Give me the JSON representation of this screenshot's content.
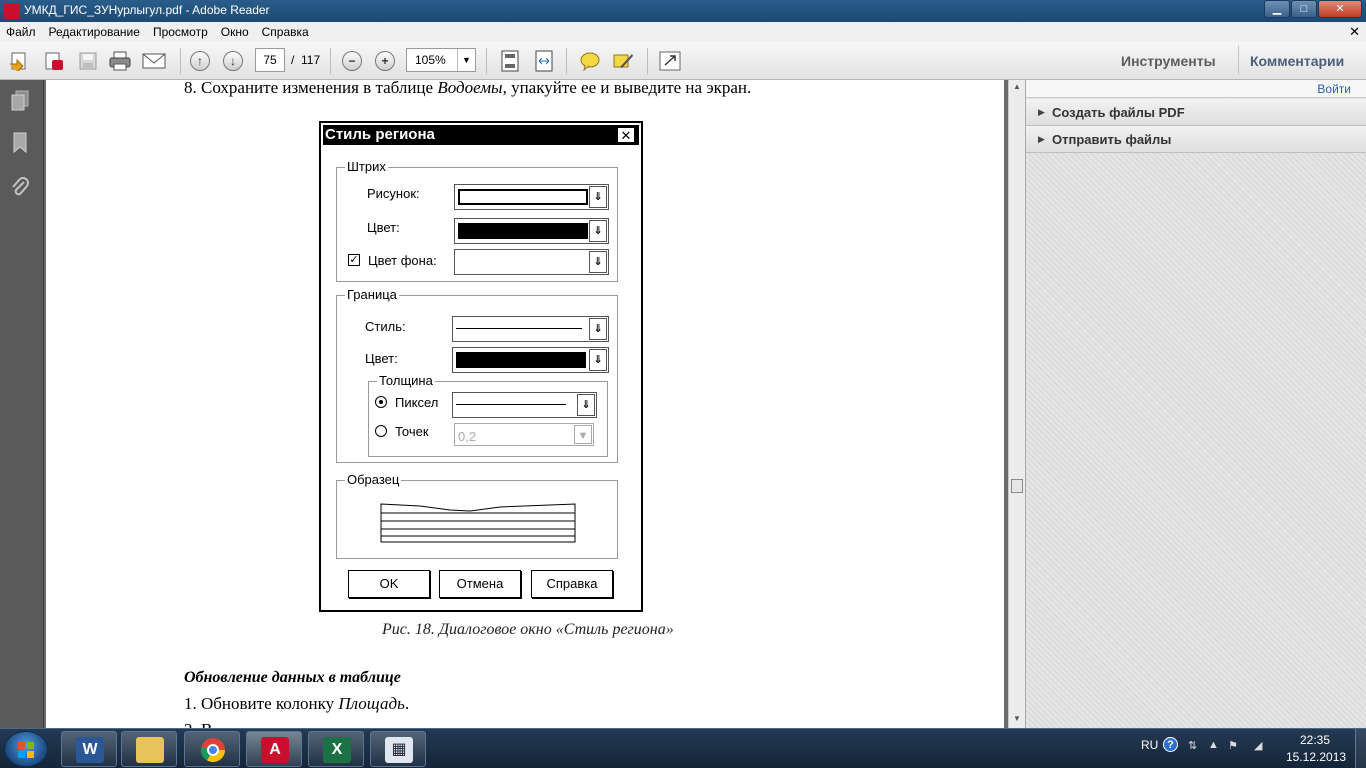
{
  "window": {
    "title": "УМКД_ГИС_ЗУНурлыгул.pdf - Adobe Reader",
    "controls": {
      "minimize": "▁",
      "maximize": "□",
      "close": "✕"
    }
  },
  "menu": {
    "items": [
      "Файл",
      "Редактирование",
      "Просмотр",
      "Окно",
      "Справка"
    ],
    "close_glyph": "✕"
  },
  "toolbar": {
    "current_page": "75",
    "page_separator": "/",
    "total_pages": "117",
    "zoom": "105%",
    "tools_label": "Инструменты",
    "comments_label": "Комментарии"
  },
  "document": {
    "line8": {
      "prefix": "8. Сохраните изменения в таблице ",
      "italic": "Водоемы",
      "suffix": ", упакуйте ее и выведите на экран."
    },
    "caption": "Рис. 18. Диалоговое окно «Стиль региона»",
    "section_heading": "Обновление данных в таблице",
    "line1": {
      "prefix": "1. Обновите колонку ",
      "italic": "Площадь",
      "suffix": "."
    },
    "line2_partial": "2. В"
  },
  "dialog": {
    "title": "Стиль региона",
    "close_glyph": "✕",
    "stroke_group": "Штрих",
    "pattern_label": "Рисунок:",
    "color_label": "Цвет:",
    "bgcolor_label": "Цвет фона:",
    "bgcolor_checked": true,
    "border_group": "Граница",
    "style_label": "Стиль:",
    "border_color_label": "Цвет:",
    "thickness_group": "Толщина",
    "pixel_label": "Пиксел",
    "points_label": "Точек",
    "points_value": "0,2",
    "sample_group": "Образец",
    "ok": "OK",
    "cancel": "Отмена",
    "help": "Справка",
    "check_glyph": "✓",
    "dropdown_glyph": "⇓"
  },
  "right_pane": {
    "sign_in": "Войти",
    "items": [
      "Создать файлы PDF",
      "Отправить файлы"
    ]
  },
  "tray": {
    "lang": "RU",
    "help": "?",
    "time": "22:35",
    "date": "15.12.2013"
  },
  "colors": {
    "titlebar": "#1d4a75",
    "taskbar": "#142538",
    "acrobat_red": "#c8102e",
    "link_blue": "#2a5db0"
  }
}
